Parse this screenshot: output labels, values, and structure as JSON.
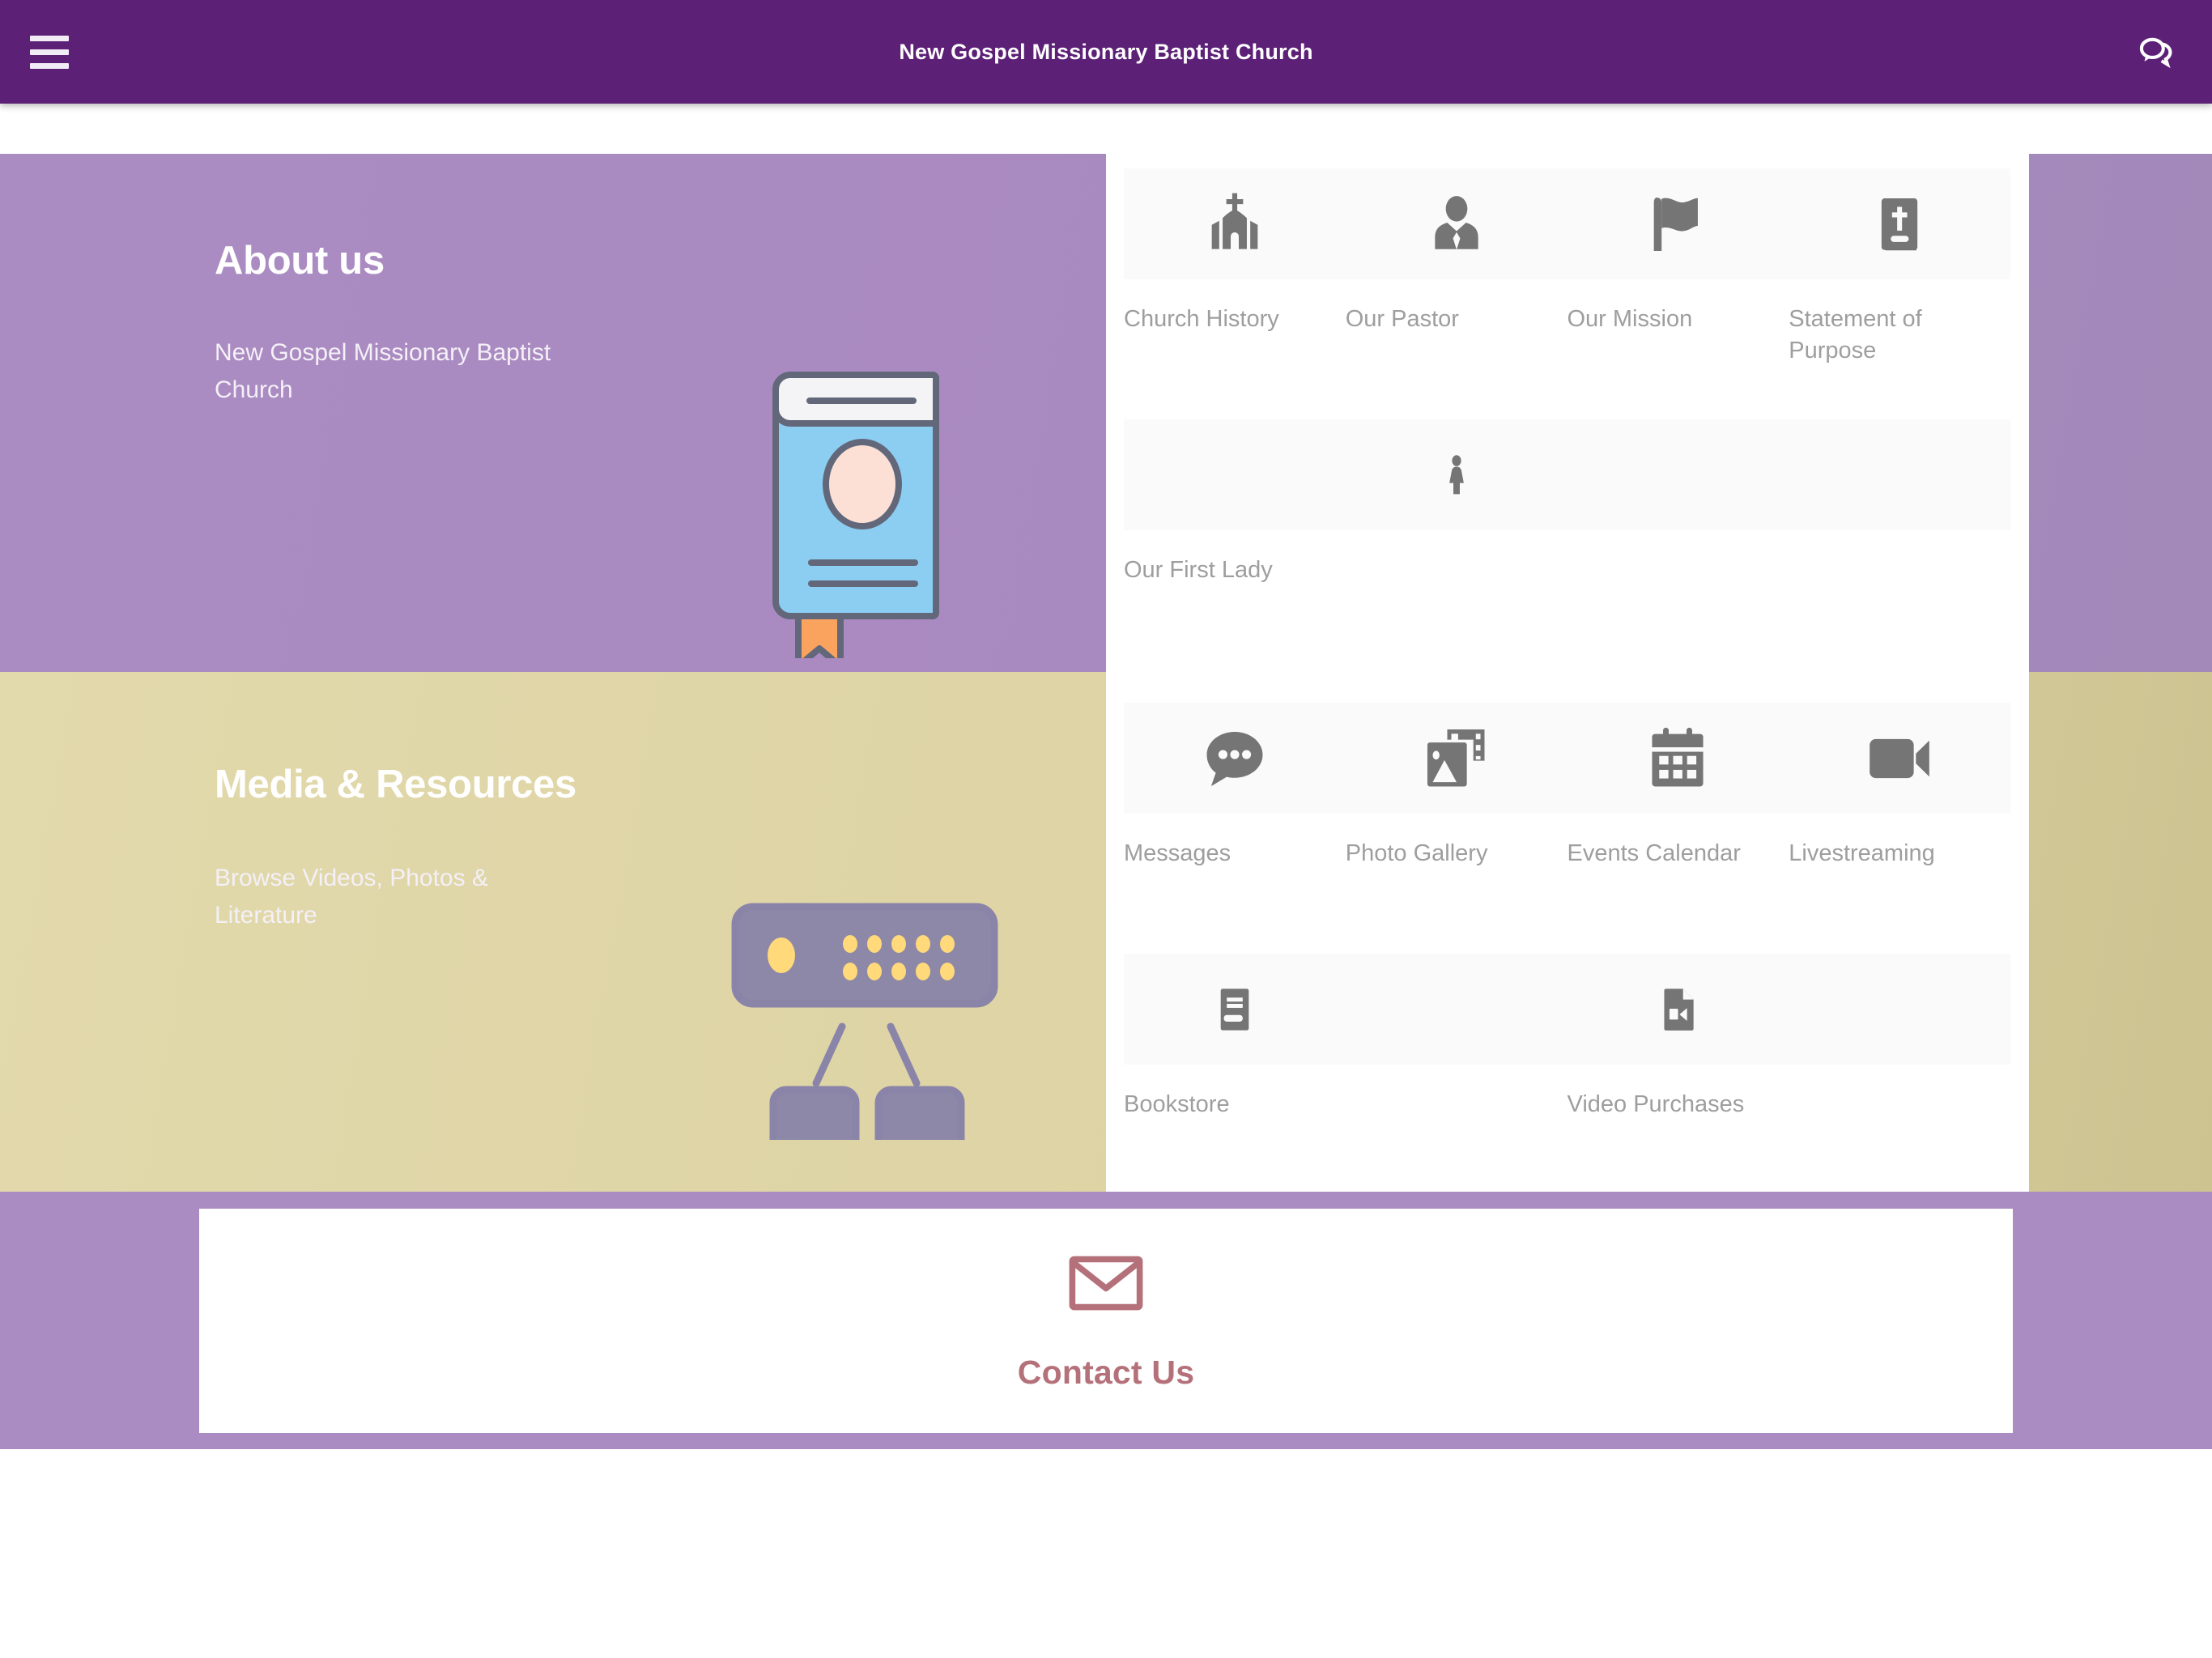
{
  "appbar": {
    "title": "New Gospel Missionary Baptist Church",
    "menu_icon": "hamburger-menu-icon",
    "chat_icon": "chat-bubbles-icon",
    "background_color": "#5d2077"
  },
  "sections": [
    {
      "id": "about",
      "title": "About us",
      "subtitle": "New Gospel Missionary Baptist Church",
      "illustration": "open-book-illustration",
      "background_color": "#ab8cc2",
      "rows": [
        {
          "cells": [
            {
              "label": "Church History",
              "icon": "church-icon"
            },
            {
              "label": "Our Pastor",
              "icon": "pastor-person-tie-icon"
            },
            {
              "label": "Our Mission",
              "icon": "flag-icon"
            },
            {
              "label": "Statement of Purpose",
              "icon": "bible-cross-book-icon"
            }
          ]
        },
        {
          "cells": [
            {
              "label": "Our First Lady",
              "icon": "",
              "icon_column": 2
            },
            {
              "label": "",
              "icon": "woman-figure-icon"
            },
            {
              "label": "",
              "icon": ""
            },
            {
              "label": "",
              "icon": ""
            }
          ]
        }
      ]
    },
    {
      "id": "media",
      "title": "Media & Resources",
      "subtitle": "Browse Videos, Photos & Literature",
      "illustration": "network-router-illustration",
      "background_color": "#e2d9ac",
      "rows": [
        {
          "cells": [
            {
              "label": "Messages",
              "icon": "speech-bubble-dots-icon"
            },
            {
              "label": "Photo Gallery",
              "icon": "photo-film-icon"
            },
            {
              "label": "Events Calendar",
              "icon": "calendar-icon"
            },
            {
              "label": "Livestreaming",
              "icon": "video-camera-icon"
            }
          ]
        },
        {
          "cells": [
            {
              "label": "Bookstore",
              "icon": "book-icon"
            },
            {
              "label": "",
              "icon": ""
            },
            {
              "label": "Video Purchases",
              "icon": "video-file-icon"
            },
            {
              "label": "",
              "icon": ""
            }
          ]
        }
      ]
    }
  ],
  "contact": {
    "label": "Contact Us",
    "icon": "envelope-mail-icon",
    "accent_color": "#b5717a"
  }
}
